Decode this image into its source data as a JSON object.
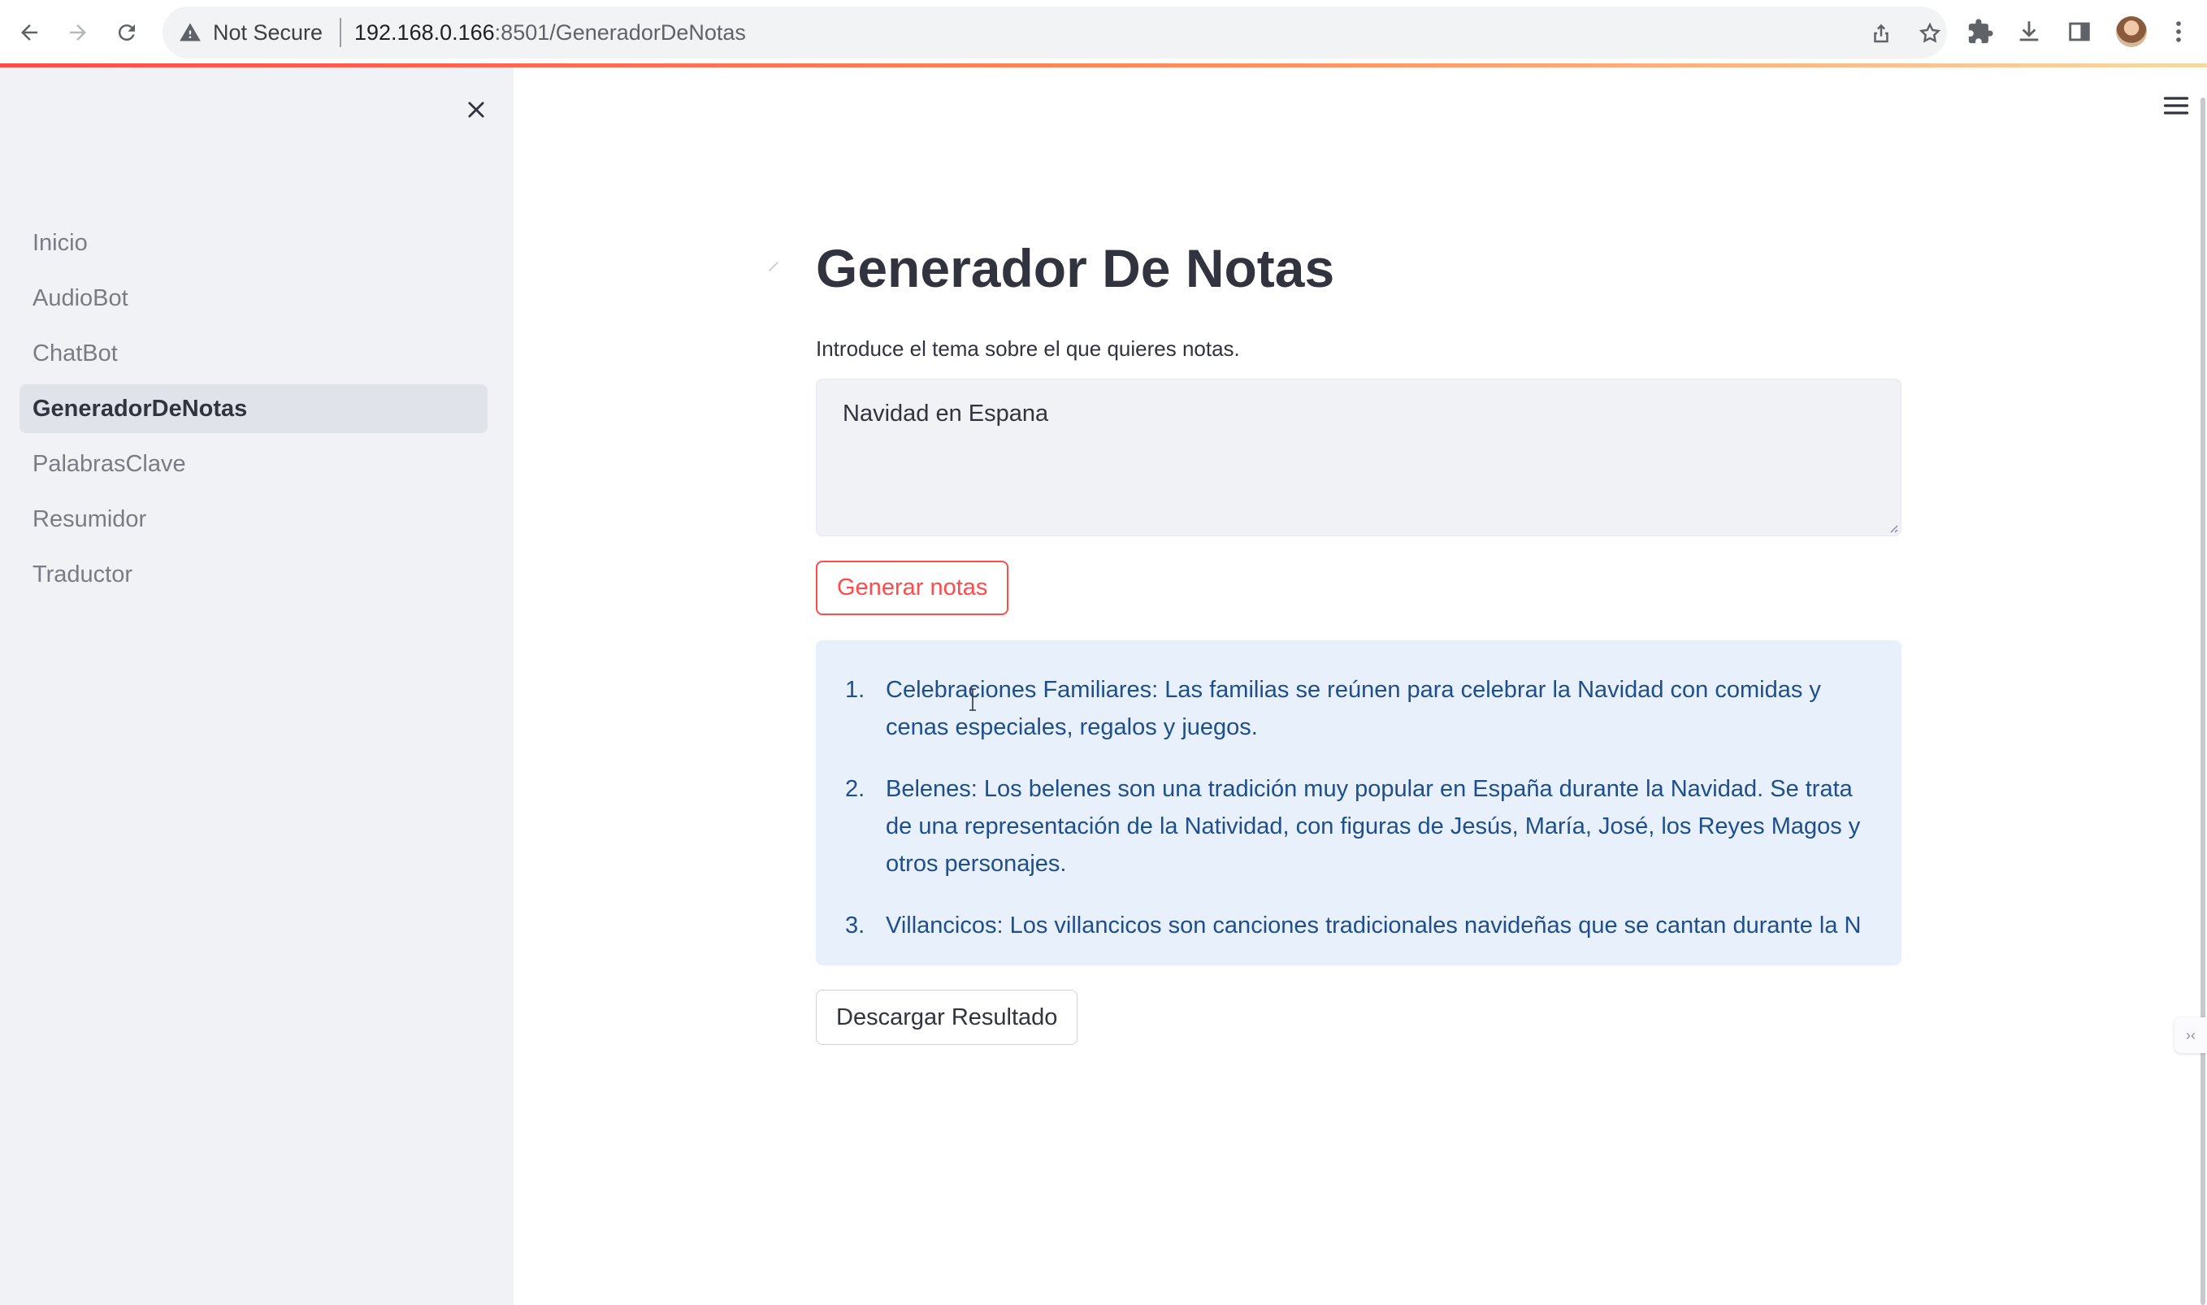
{
  "browser": {
    "security_label": "Not Secure",
    "url_host": "192.168.0.166",
    "url_path": ":8501/GeneradorDeNotas"
  },
  "sidebar": {
    "items": [
      {
        "label": "Inicio",
        "active": false
      },
      {
        "label": "AudioBot",
        "active": false
      },
      {
        "label": "ChatBot",
        "active": false
      },
      {
        "label": "GeneradorDeNotas",
        "active": true
      },
      {
        "label": "PalabrasClave",
        "active": false
      },
      {
        "label": "Resumidor",
        "active": false
      },
      {
        "label": "Traductor",
        "active": false
      }
    ]
  },
  "main": {
    "title": "Generador De Notas",
    "instruction": "Introduce el tema sobre el que quieres notas.",
    "topic_value": "Navidad en Espana",
    "generate_label": "Generar notas",
    "results": [
      {
        "num": "1.",
        "text": "Celebraciones Familiares: Las familias se reúnen para celebrar la Navidad con comidas y cenas especiales, regalos y juegos."
      },
      {
        "num": "2.",
        "text": "Belenes: Los belenes son una tradición muy popular en España durante la Navidad. Se trata de una representación de la Natividad, con figuras de Jesús, María, José, los Reyes Magos y otros personajes."
      },
      {
        "num": "3.",
        "text": "Villancicos: Los villancicos son canciones tradicionales navideñas que se cantan durante la N"
      }
    ],
    "download_label": "Descargar Resultado"
  },
  "colors": {
    "accent": "#ff4b4b",
    "sidebar_bg": "#f0f2f6",
    "result_bg": "#e8f0fb",
    "result_text": "#1f4e8c"
  }
}
